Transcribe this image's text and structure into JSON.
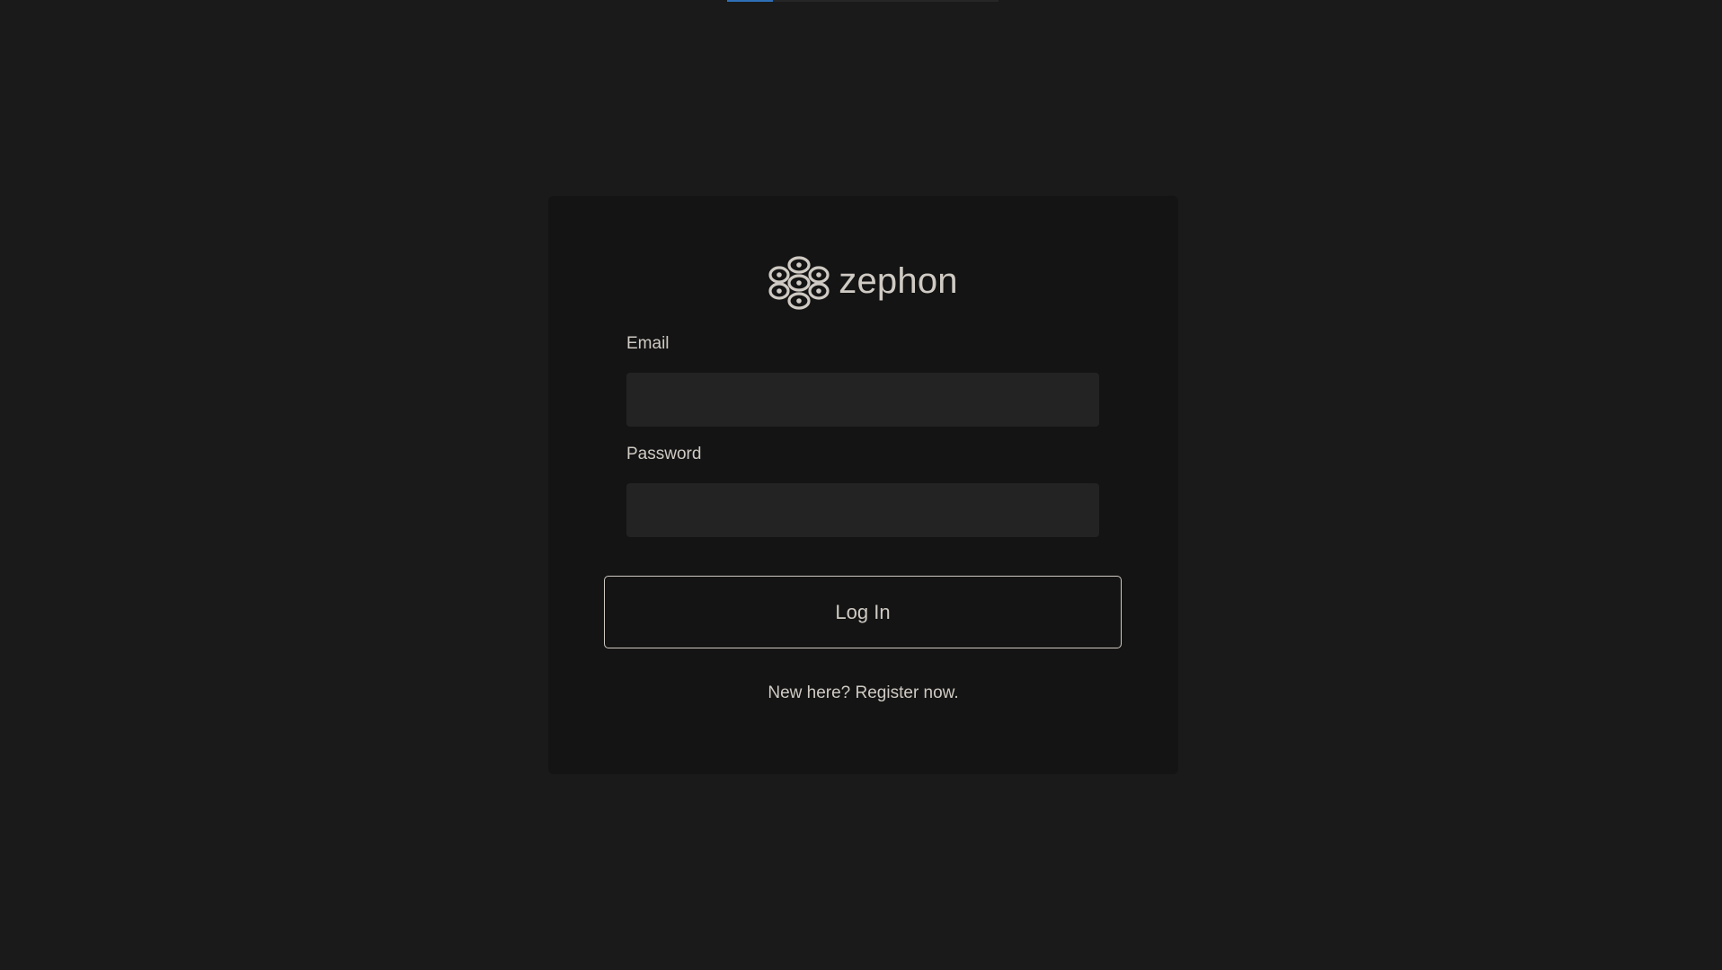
{
  "page": {
    "background_color": "#1a1a1a",
    "card_color": "#141414",
    "text_color": "#cfcac3",
    "accent_color": "#2f6fb8"
  },
  "loading_bar": {
    "progress": 0.17
  },
  "brand": {
    "name": "zephon",
    "logo_icon": "zephon-logo-icon"
  },
  "form": {
    "email_label": "Email",
    "email_value": "",
    "email_placeholder": "",
    "password_label": "Password",
    "password_value": "",
    "password_placeholder": "",
    "submit_label": "Log In"
  },
  "register": {
    "text": "New here? Register now."
  }
}
